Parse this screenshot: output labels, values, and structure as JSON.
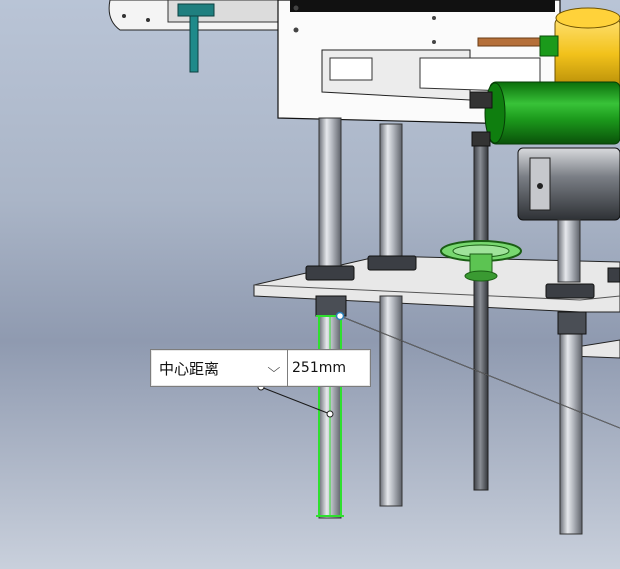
{
  "measurement": {
    "type_label": "中心距离",
    "value": "251mm"
  },
  "icons": {
    "dropdown": "chevron-down-icon"
  },
  "colors": {
    "accent_green": "#17a117",
    "motor_yellow": "#f2c21b",
    "highlight_green": "#2fe02f"
  }
}
